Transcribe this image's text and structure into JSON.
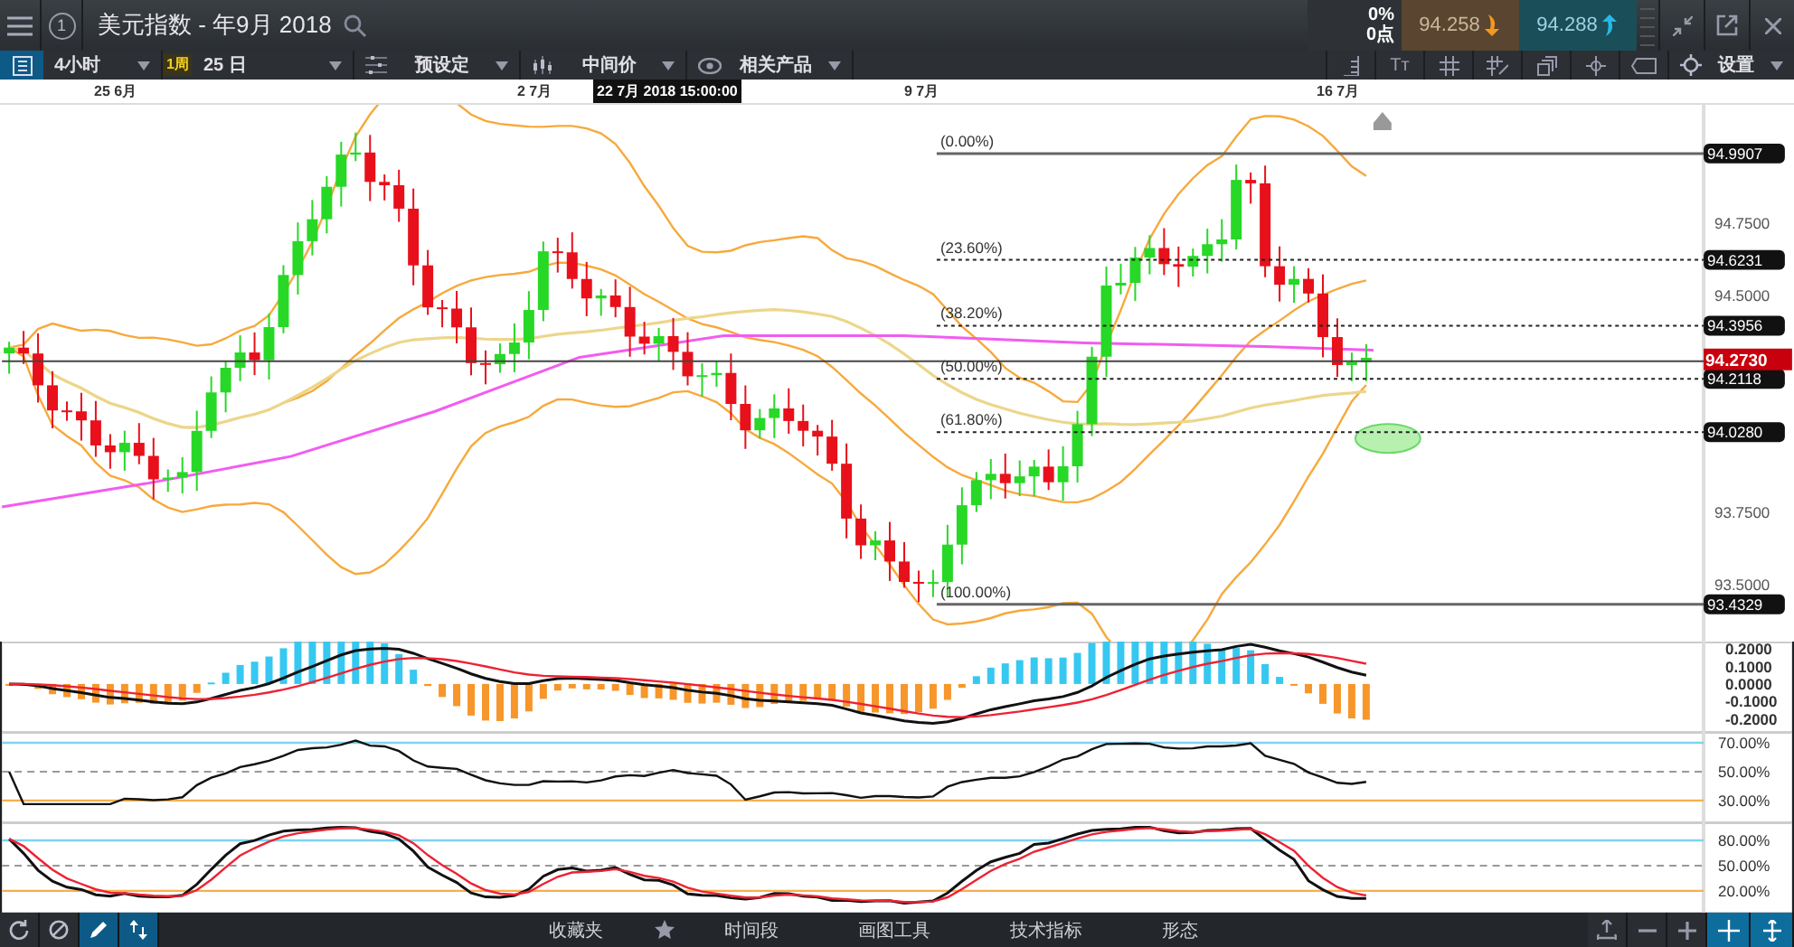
{
  "window": {
    "title": "美元指数 - 年9月 2018",
    "badge": "1"
  },
  "quote": {
    "change_percent": "0%",
    "change_points": "0点",
    "sell": "94.258",
    "buy": "94.288"
  },
  "toolbar": {
    "interval": "4小时",
    "range_badge": "1周",
    "range": "25 日",
    "menus": [
      {
        "label": "预设定",
        "kind": "presets"
      },
      {
        "label": "中间价",
        "kind": "price"
      },
      {
        "label": "相关产品",
        "kind": "related"
      }
    ],
    "text_size": "Tт",
    "settings": "设置"
  },
  "date_axis": {
    "labels": [
      "25 6月",
      "2 7月",
      "9 7月",
      "16 7月"
    ],
    "crosshair": "22 7月 2018 15:00:00"
  },
  "price_axis": {
    "ticks": [
      "94.7500",
      "94.5000",
      "93.7500",
      "93.5000"
    ],
    "current": "94.2730"
  },
  "fibonacci": [
    {
      "label": "(0.00%)",
      "price": "94.9907"
    },
    {
      "label": "(23.60%)",
      "price": "94.6231"
    },
    {
      "label": "(38.20%)",
      "price": "94.3956"
    },
    {
      "label": "(50.00%)",
      "price": "94.2118"
    },
    {
      "label": "(61.80%)",
      "price": "94.0280"
    },
    {
      "label": "(100.00%)",
      "price": "93.4329"
    }
  ],
  "indicators": [
    {
      "kind": "macd",
      "ticks": [
        "0.2000",
        "0.1000",
        "0.0000",
        "-0.1000",
        "-0.2000"
      ]
    },
    {
      "kind": "rsi",
      "ticks": [
        "70.00%",
        "50.00%",
        "30.00%"
      ]
    },
    {
      "kind": "stochastic",
      "ticks": [
        "80.00%",
        "50.00%",
        "20.00%"
      ]
    }
  ],
  "bottom_tabs": [
    "收藏夹",
    "时间段",
    "画图工具",
    "技术指标",
    "形态"
  ]
}
